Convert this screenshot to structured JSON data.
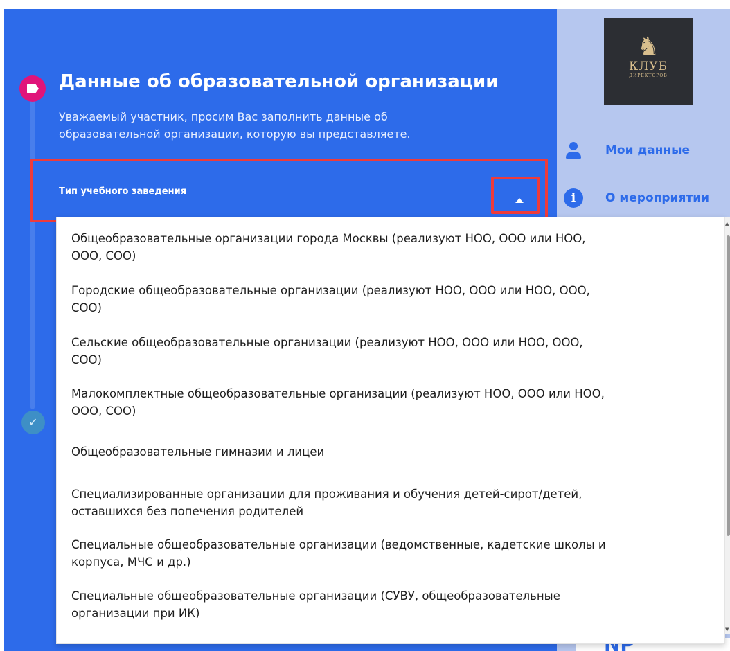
{
  "form": {
    "title": "Данные об образовательной организации",
    "description_lines": [
      "Уважаемый участник, просим Вас заполнить данные об",
      "образовательной организации, которую вы представляете."
    ],
    "select": {
      "label": "Тип учебного заведения",
      "options": [
        {
          "lines": [
            "Общеобразовательные организации города Москвы (реализуют НОО, ООО или НОО,",
            "ООО, СОО)"
          ]
        },
        {
          "lines": [
            "Городские общеобразовательные организации (реализуют НОО, ООО или НОО, ООО,",
            "СОО)"
          ]
        },
        {
          "lines": [
            "Сельские общеобразовательные организации (реализуют НОО, ООО или НОО, ООО,",
            "СОО)"
          ]
        },
        {
          "lines": [
            "Малокомплектные общеобразовательные организации (реализуют НОО, ООО или НОО,",
            "ООО, СОО)"
          ]
        },
        {
          "lines": [
            "Общеобразовательные гимназии и лицеи"
          ]
        },
        {
          "lines": [
            "Специализированные организации для проживания и обучения детей-сирот/детей,",
            "оставшихся без попечения родителей"
          ]
        },
        {
          "lines": [
            "Специальные общеобразовательные организации (ведомственные, кадетские школы и",
            "корпуса, МЧС и др.)"
          ]
        },
        {
          "lines": [
            "Специальные общеобразовательные организации (СУВУ, общеобразовательные",
            "организации при ИК)"
          ]
        }
      ]
    },
    "steps": {
      "done_icon": "✓"
    }
  },
  "sidebar": {
    "logo": {
      "mark": "♞",
      "text": "КЛУБ",
      "subtext": "ДИРЕКТОРОВ"
    },
    "nav": [
      {
        "label": "Мои данные",
        "icon": "user-icon"
      },
      {
        "label": "О мероприятии",
        "icon": "info-icon"
      }
    ],
    "bottom_badge_text": "NP"
  },
  "colors": {
    "form_bg": "#2d6bea",
    "sidebar_bg": "#b6c7ef",
    "highlight": "#ee3b3b",
    "accent": "#e0147a",
    "step_done": "#3e8fc6"
  }
}
